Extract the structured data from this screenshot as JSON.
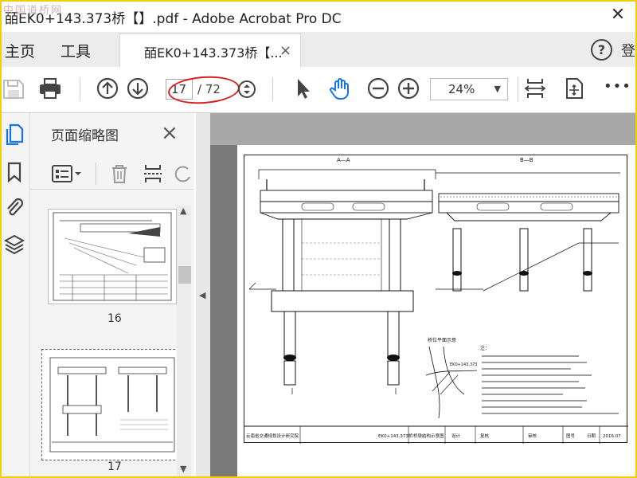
{
  "window": {
    "title": "皕EK0+143.373桥【】.pdf - Adobe Acrobat Pro DC",
    "watermark": "中国道桥网"
  },
  "menu": {
    "home": "主页",
    "tools": "工具"
  },
  "tab": {
    "label": "皕EK0+143.373桥【...",
    "close": "×",
    "partial_right": "登"
  },
  "toolbar": {
    "current_page": "17",
    "total_pages": "/ 72",
    "zoom": "24%",
    "zoom_caret": "▼",
    "more": "•••"
  },
  "panel": {
    "title": "页面缩略图",
    "close": "×",
    "thumbs": [
      {
        "page": "16"
      },
      {
        "page": "17"
      }
    ]
  },
  "drawing": {
    "section_a": "A—A",
    "section_b": "B—B",
    "plan_title": "桥位平面示意",
    "mark": "EK0+143.373",
    "notes_title": "注：",
    "title_block": {
      "org": "云南省交通规划设计研究院",
      "project": "EK0+143.373桥",
      "sheet_name": "桥墩结构示意图",
      "design": "设计",
      "review": "复核",
      "check": "审核",
      "fig_no": "图号",
      "date_label": "日期",
      "date": "2016.07"
    }
  },
  "colors": {
    "accent": "#1473e6",
    "annotation": "#d81e1e",
    "highlight_border": "#f0d000"
  }
}
